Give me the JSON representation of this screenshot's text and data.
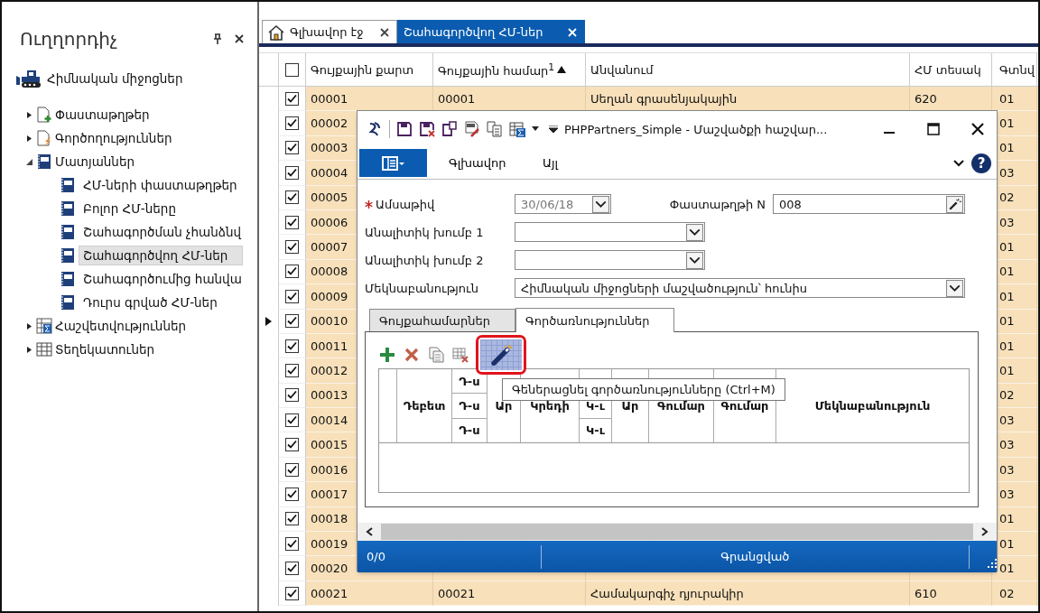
{
  "sidebar": {
    "title": "Ուղղորդիչ",
    "root": "Հիմնական միջոցներ",
    "items": [
      {
        "label": "Փաստաթղթեր",
        "kind": "document",
        "expanded": false
      },
      {
        "label": "Գործողություններ",
        "kind": "operation",
        "expanded": false
      },
      {
        "label": "Մատյաններ",
        "kind": "journal",
        "expanded": true,
        "children": [
          {
            "label": "ՀՄ-ների փաստաթղթեր",
            "selected": false
          },
          {
            "label": "Բոլոր ՀՄ-ները",
            "selected": false
          },
          {
            "label": "Շահագործման չհանձնվ",
            "selected": false
          },
          {
            "label": "Շահագործվող ՀՄ-ներ",
            "selected": true
          },
          {
            "label": "Շահագործումից հանվա",
            "selected": false
          },
          {
            "label": "Դուրս գրված ՀՄ-ներ",
            "selected": false
          }
        ]
      },
      {
        "label": "Հաշվետվություններ",
        "kind": "report",
        "expanded": false
      },
      {
        "label": "Տեղեկատուներ",
        "kind": "table",
        "expanded": false
      }
    ]
  },
  "tabs": [
    {
      "label": "Գլխավոր էջ",
      "kind": "home",
      "selected": false
    },
    {
      "label": "Շահագործվող ՀՄ-ներ",
      "kind": "plain",
      "selected": true
    }
  ],
  "table": {
    "all_checked": false,
    "columns": [
      {
        "label": "Գույքային քարտ",
        "sorted": false
      },
      {
        "label": "Գույքային համար$^{1}$",
        "sorted": true
      },
      {
        "label": "Անվանում",
        "sorted": false
      },
      {
        "label": "ՀՄ տեսակ",
        "sorted": false
      },
      {
        "label": "Գտնվ",
        "sorted": false
      }
    ],
    "rows": [
      {
        "checked": true,
        "current": false,
        "cells": [
          "00001",
          "00001",
          "Սեղան գրասենյակային",
          "620",
          "01"
        ]
      },
      {
        "checked": true,
        "current": false,
        "cells": [
          "00002",
          null,
          null,
          null,
          "01"
        ]
      },
      {
        "checked": true,
        "current": false,
        "cells": [
          "00003",
          null,
          null,
          null,
          "01"
        ]
      },
      {
        "checked": true,
        "current": false,
        "cells": [
          "00004",
          null,
          null,
          null,
          "03"
        ]
      },
      {
        "checked": true,
        "current": false,
        "cells": [
          "00005",
          null,
          null,
          null,
          "02"
        ]
      },
      {
        "checked": true,
        "current": false,
        "cells": [
          "00006",
          null,
          null,
          null,
          "03"
        ]
      },
      {
        "checked": true,
        "current": false,
        "cells": [
          "00007",
          null,
          null,
          null,
          "01"
        ]
      },
      {
        "checked": true,
        "current": false,
        "cells": [
          "00008",
          null,
          null,
          null,
          "01"
        ]
      },
      {
        "checked": true,
        "current": false,
        "cells": [
          "00009",
          null,
          null,
          null,
          "01"
        ]
      },
      {
        "checked": true,
        "current": true,
        "cells": [
          "00010",
          null,
          null,
          null,
          "01"
        ]
      },
      {
        "checked": true,
        "current": false,
        "cells": [
          "00011",
          null,
          null,
          null,
          "01"
        ]
      },
      {
        "checked": true,
        "current": false,
        "cells": [
          "00012",
          null,
          null,
          null,
          "01"
        ]
      },
      {
        "checked": true,
        "current": false,
        "cells": [
          "00013",
          null,
          null,
          null,
          "02"
        ]
      },
      {
        "checked": true,
        "current": false,
        "cells": [
          "00014",
          null,
          null,
          null,
          "03"
        ]
      },
      {
        "checked": true,
        "current": false,
        "cells": [
          "00015",
          null,
          null,
          null,
          "03"
        ]
      },
      {
        "checked": true,
        "current": false,
        "cells": [
          "00016",
          null,
          null,
          null,
          "03"
        ]
      },
      {
        "checked": true,
        "current": false,
        "cells": [
          "00017",
          null,
          null,
          null,
          "03"
        ]
      },
      {
        "checked": true,
        "current": false,
        "cells": [
          "00018",
          null,
          null,
          null,
          "01"
        ]
      },
      {
        "checked": true,
        "current": false,
        "cells": [
          "00019",
          null,
          null,
          null,
          "01"
        ]
      },
      {
        "checked": true,
        "current": false,
        "cells": [
          "00020",
          null,
          null,
          null,
          "01"
        ]
      },
      {
        "checked": true,
        "current": false,
        "cells": [
          "00021",
          "00021",
          "Համակարգիչ դյուրակիր",
          "610",
          "02"
        ]
      }
    ]
  },
  "dialog": {
    "title": "PHPPartners_Simple - Մաշվածքի հաշվար...",
    "ribbon_tabs": [
      {
        "label": "Գլխավոր"
      },
      {
        "label": "Այլ"
      }
    ],
    "help": "?",
    "date": {
      "label": "Ամսաթիվ",
      "required": true,
      "disabled": true,
      "value": "30/06/18"
    },
    "document_no": {
      "label": "Փաստաթղթի N",
      "value": "008"
    },
    "fields": [
      {
        "label": "Անալիտիկ խումբ 1",
        "kind": "short"
      },
      {
        "label": "Անալիտիկ խումբ 2",
        "kind": "short"
      },
      {
        "label": "Մեկնաբանություն",
        "kind": "wide",
        "value": "Հիմնական միջոցների մաշվածություն՝ հունիս"
      }
    ],
    "tabs": [
      {
        "label": "Գույքահամարներ",
        "selected": false
      },
      {
        "label": "Գործառնություններ",
        "selected": true
      }
    ],
    "toolbar": [
      {
        "kind": "add",
        "highlighted": false
      },
      {
        "kind": "delete",
        "highlighted": false
      },
      {
        "kind": "copy",
        "highlighted": false
      },
      {
        "kind": "clear",
        "highlighted": false
      },
      {
        "kind": "generate",
        "highlighted": true
      }
    ],
    "tooltip": "Գեներացնել գործառնությունները (Ctrl+M)",
    "grid_columns": [
      {
        "kind": "blank"
      },
      {
        "kind": "single",
        "label": "Դեբետ"
      },
      {
        "kind": "stack",
        "labels": [
          "Դ-ս",
          "Դ-ս",
          "Դ-ս"
        ]
      },
      {
        "kind": "single",
        "label": "Ար"
      },
      {
        "kind": "single",
        "label": "Կրեդի"
      },
      {
        "kind": "stack_lower",
        "labels": [
          "Կ-ւ",
          "Կ-ւ"
        ]
      },
      {
        "kind": "single",
        "label": "Ար"
      },
      {
        "kind": "single",
        "label": "Գումար"
      },
      {
        "kind": "single",
        "label": "Գումար"
      },
      {
        "kind": "single",
        "label": "Մեկնաբանություն"
      }
    ],
    "status_bar": {
      "count": "0/0",
      "state": "Գրանցված"
    }
  }
}
